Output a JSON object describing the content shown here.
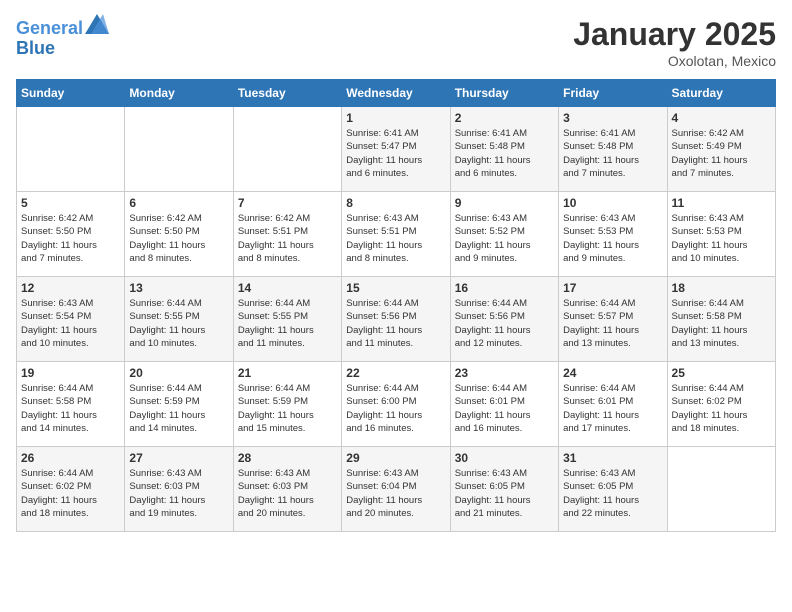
{
  "header": {
    "logo_line1": "General",
    "logo_line2": "Blue",
    "month": "January 2025",
    "location": "Oxolotan, Mexico"
  },
  "weekdays": [
    "Sunday",
    "Monday",
    "Tuesday",
    "Wednesday",
    "Thursday",
    "Friday",
    "Saturday"
  ],
  "weeks": [
    [
      {
        "day": "",
        "info": ""
      },
      {
        "day": "",
        "info": ""
      },
      {
        "day": "",
        "info": ""
      },
      {
        "day": "1",
        "info": "Sunrise: 6:41 AM\nSunset: 5:47 PM\nDaylight: 11 hours\nand 6 minutes."
      },
      {
        "day": "2",
        "info": "Sunrise: 6:41 AM\nSunset: 5:48 PM\nDaylight: 11 hours\nand 6 minutes."
      },
      {
        "day": "3",
        "info": "Sunrise: 6:41 AM\nSunset: 5:48 PM\nDaylight: 11 hours\nand 7 minutes."
      },
      {
        "day": "4",
        "info": "Sunrise: 6:42 AM\nSunset: 5:49 PM\nDaylight: 11 hours\nand 7 minutes."
      }
    ],
    [
      {
        "day": "5",
        "info": "Sunrise: 6:42 AM\nSunset: 5:50 PM\nDaylight: 11 hours\nand 7 minutes."
      },
      {
        "day": "6",
        "info": "Sunrise: 6:42 AM\nSunset: 5:50 PM\nDaylight: 11 hours\nand 8 minutes."
      },
      {
        "day": "7",
        "info": "Sunrise: 6:42 AM\nSunset: 5:51 PM\nDaylight: 11 hours\nand 8 minutes."
      },
      {
        "day": "8",
        "info": "Sunrise: 6:43 AM\nSunset: 5:51 PM\nDaylight: 11 hours\nand 8 minutes."
      },
      {
        "day": "9",
        "info": "Sunrise: 6:43 AM\nSunset: 5:52 PM\nDaylight: 11 hours\nand 9 minutes."
      },
      {
        "day": "10",
        "info": "Sunrise: 6:43 AM\nSunset: 5:53 PM\nDaylight: 11 hours\nand 9 minutes."
      },
      {
        "day": "11",
        "info": "Sunrise: 6:43 AM\nSunset: 5:53 PM\nDaylight: 11 hours\nand 10 minutes."
      }
    ],
    [
      {
        "day": "12",
        "info": "Sunrise: 6:43 AM\nSunset: 5:54 PM\nDaylight: 11 hours\nand 10 minutes."
      },
      {
        "day": "13",
        "info": "Sunrise: 6:44 AM\nSunset: 5:55 PM\nDaylight: 11 hours\nand 10 minutes."
      },
      {
        "day": "14",
        "info": "Sunrise: 6:44 AM\nSunset: 5:55 PM\nDaylight: 11 hours\nand 11 minutes."
      },
      {
        "day": "15",
        "info": "Sunrise: 6:44 AM\nSunset: 5:56 PM\nDaylight: 11 hours\nand 11 minutes."
      },
      {
        "day": "16",
        "info": "Sunrise: 6:44 AM\nSunset: 5:56 PM\nDaylight: 11 hours\nand 12 minutes."
      },
      {
        "day": "17",
        "info": "Sunrise: 6:44 AM\nSunset: 5:57 PM\nDaylight: 11 hours\nand 13 minutes."
      },
      {
        "day": "18",
        "info": "Sunrise: 6:44 AM\nSunset: 5:58 PM\nDaylight: 11 hours\nand 13 minutes."
      }
    ],
    [
      {
        "day": "19",
        "info": "Sunrise: 6:44 AM\nSunset: 5:58 PM\nDaylight: 11 hours\nand 14 minutes."
      },
      {
        "day": "20",
        "info": "Sunrise: 6:44 AM\nSunset: 5:59 PM\nDaylight: 11 hours\nand 14 minutes."
      },
      {
        "day": "21",
        "info": "Sunrise: 6:44 AM\nSunset: 5:59 PM\nDaylight: 11 hours\nand 15 minutes."
      },
      {
        "day": "22",
        "info": "Sunrise: 6:44 AM\nSunset: 6:00 PM\nDaylight: 11 hours\nand 16 minutes."
      },
      {
        "day": "23",
        "info": "Sunrise: 6:44 AM\nSunset: 6:01 PM\nDaylight: 11 hours\nand 16 minutes."
      },
      {
        "day": "24",
        "info": "Sunrise: 6:44 AM\nSunset: 6:01 PM\nDaylight: 11 hours\nand 17 minutes."
      },
      {
        "day": "25",
        "info": "Sunrise: 6:44 AM\nSunset: 6:02 PM\nDaylight: 11 hours\nand 18 minutes."
      }
    ],
    [
      {
        "day": "26",
        "info": "Sunrise: 6:44 AM\nSunset: 6:02 PM\nDaylight: 11 hours\nand 18 minutes."
      },
      {
        "day": "27",
        "info": "Sunrise: 6:43 AM\nSunset: 6:03 PM\nDaylight: 11 hours\nand 19 minutes."
      },
      {
        "day": "28",
        "info": "Sunrise: 6:43 AM\nSunset: 6:03 PM\nDaylight: 11 hours\nand 20 minutes."
      },
      {
        "day": "29",
        "info": "Sunrise: 6:43 AM\nSunset: 6:04 PM\nDaylight: 11 hours\nand 20 minutes."
      },
      {
        "day": "30",
        "info": "Sunrise: 6:43 AM\nSunset: 6:05 PM\nDaylight: 11 hours\nand 21 minutes."
      },
      {
        "day": "31",
        "info": "Sunrise: 6:43 AM\nSunset: 6:05 PM\nDaylight: 11 hours\nand 22 minutes."
      },
      {
        "day": "",
        "info": ""
      }
    ]
  ]
}
